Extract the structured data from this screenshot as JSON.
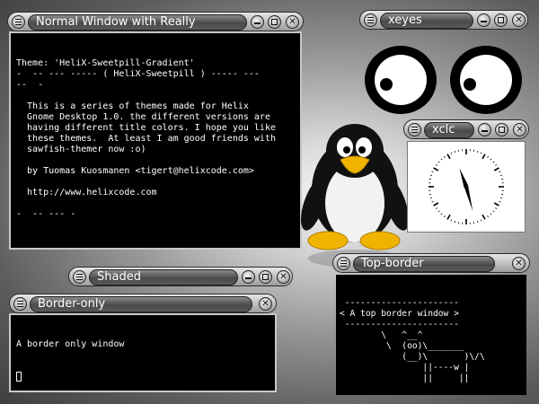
{
  "windows": {
    "normal": {
      "title": "Normal Window with Really",
      "lines": [
        "Theme: 'HeliX-Sweetpill-Gradient'",
        "-  -- --- ----- ( HeliX-Sweetpill ) ----- ---",
        "--  -",
        "",
        "  This is a series of themes made for Helix",
        "  Gnome Desktop 1.0. the different versions are",
        "  having different title colors. I hope you like",
        "  these themes.  At least I am good friends with",
        "  sawfish-themer now :o)",
        "",
        "  by Tuomas Kuosmanen <tigert@helixcode.com>",
        "",
        "  http://www.helixcode.com",
        "",
        "-  -- --- -"
      ]
    },
    "xeyes": {
      "title": "xeyes"
    },
    "xclock": {
      "title": "xclc"
    },
    "shaded": {
      "title": "Shaded"
    },
    "border_only": {
      "title": "Border-only",
      "lines": [
        "A border only window"
      ]
    },
    "top_border": {
      "title": "Top-border",
      "lines": [
        " ----------------------",
        "< A top border window >",
        " ----------------------",
        "        \\   ^__^",
        "         \\  (oo)\\_______",
        "            (__)\\       )\\/\\",
        "                ||----w |",
        "                ||     ||"
      ]
    }
  },
  "colors": {
    "terminal_bg": "#000000",
    "terminal_fg": "#ffffff",
    "title_text": "#ffffff"
  }
}
